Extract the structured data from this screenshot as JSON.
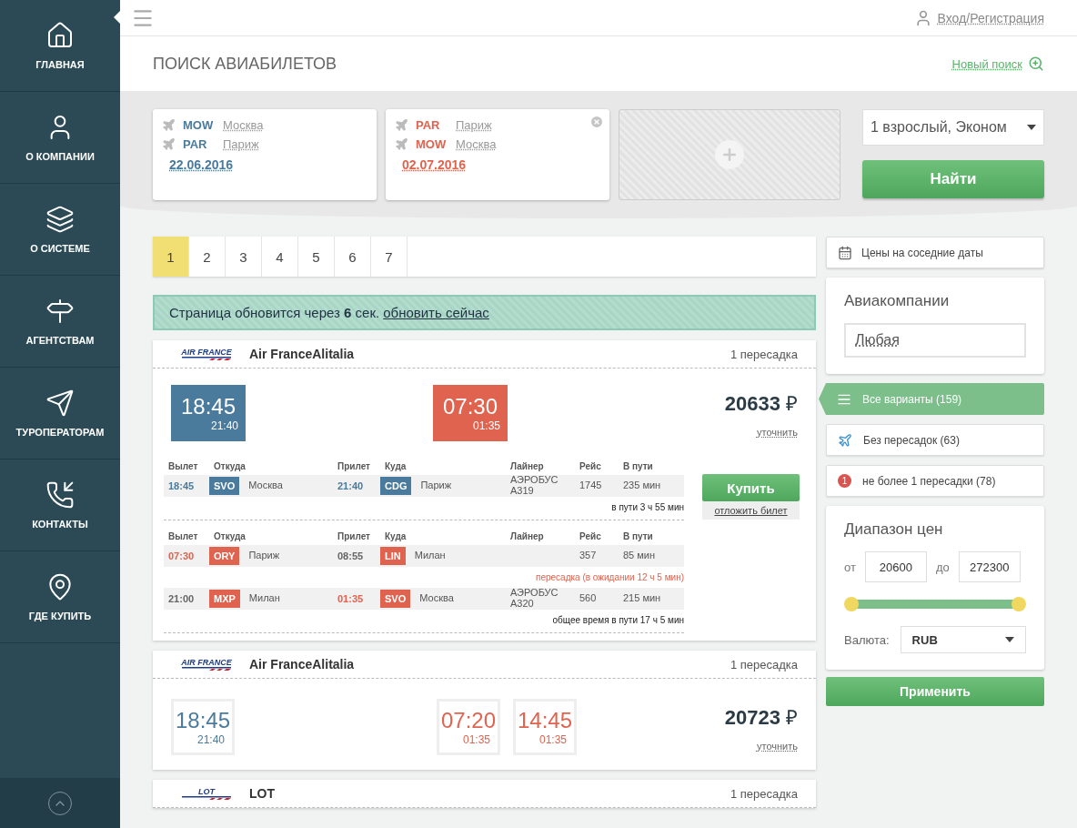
{
  "sidebar": {
    "items": [
      {
        "label": "ГЛАВНАЯ",
        "selected": true
      },
      {
        "label": "О КОМПАНИИ",
        "selected": false
      },
      {
        "label": "О СИСТЕМЕ",
        "selected": false
      },
      {
        "label": "АГЕНТСТВАМ",
        "selected": false
      },
      {
        "label": "ТУРОПЕРАТОРАМ",
        "selected": false
      },
      {
        "label": "КОНТАКТЫ",
        "selected": false
      },
      {
        "label": "ГДЕ КУПИТЬ",
        "selected": false
      }
    ]
  },
  "header": {
    "login": "Вход/Регистрация",
    "page_title": "ПОИСК АВИАБИЛЕТОВ",
    "new_search": "Новый поиск"
  },
  "search": {
    "legs": [
      {
        "color": "#4a7a9c",
        "removable": false,
        "from_code": "MOW",
        "from_city": "Москва",
        "to_code": "PAR",
        "to_city": "Париж",
        "date": "22.06.2016"
      },
      {
        "color": "#e0634f",
        "removable": true,
        "from_code": "PAR",
        "from_city": "Париж",
        "to_code": "MOW",
        "to_city": "Москва",
        "date": "02.07.2016"
      }
    ],
    "passengers": "1 взрослый, Эконом",
    "find_button": "Найти"
  },
  "pagination": [
    {
      "label": "1",
      "selected": true
    },
    {
      "label": "2",
      "selected": false
    },
    {
      "label": "3",
      "selected": false
    },
    {
      "label": "4",
      "selected": false
    },
    {
      "label": "5",
      "selected": false
    },
    {
      "label": "6",
      "selected": false
    },
    {
      "label": "7",
      "selected": false
    }
  ],
  "notice": {
    "text": "Страница обновится через **6** сек.",
    "link": "обновить сейчас"
  },
  "results": [
    {
      "logo": "AIR FRANCE",
      "airline": "Air FranceAlitalia",
      "transfers": "1 пересадка",
      "expanded": true,
      "times": [
        {
          "time": "18:45",
          "sub": "21:40",
          "color": "#4a7a9c"
        },
        {
          "time": "07:30",
          "sub": "01:35",
          "color": "#e0634f"
        }
      ],
      "price": "20633",
      "currency": "₽",
      "refine": "уточнить",
      "buy": "Купить",
      "postpone": "отложить билет",
      "legs": [
        {
          "color": "#4a7a9c",
          "columns": [
            "Вылет",
            "Откуда",
            "Прилет",
            "Куда",
            "Лайнер",
            "Рейс",
            "В пути"
          ],
          "segments": [
            {
              "dep": "18:45",
              "dep_highlight": true,
              "from_code": "SVO",
              "from_city": "Москва",
              "arr": "21:40",
              "arr_highlight": true,
              "to_code": "CDG",
              "to_city": "Париж",
              "aircraft": "АЭРОБУС A319",
              "flight": "1745",
              "duration": "235 мин"
            }
          ],
          "total": "в пути 3 ч 55 мин"
        },
        {
          "color": "#e0634f",
          "columns": [
            "Вылет",
            "Откуда",
            "Прилет",
            "Куда",
            "Лайнер",
            "Рейс",
            "В пути"
          ],
          "segments": [
            {
              "dep": "07:30",
              "dep_highlight": true,
              "from_code": "ORY",
              "from_city": "Париж",
              "arr": "08:55",
              "arr_highlight": false,
              "to_code": "LIN",
              "to_city": "Милан",
              "flight": "357",
              "duration": "85 мин"
            },
            {
              "dep": "21:00",
              "dep_highlight": false,
              "from_code": "MXP",
              "from_city": "Милан",
              "arr": "01:35",
              "arr_highlight": true,
              "to_code": "SVO",
              "to_city": "Москва",
              "aircraft": "АЭРОБУС A320",
              "flight": "560",
              "duration": "215 мин"
            }
          ],
          "transfer": "пересадка (в ожидании 12 ч 5 мин)",
          "total": "общее время в пути 17 ч 5 мин"
        }
      ]
    },
    {
      "logo": "AIR FRANCE",
      "airline": "Air FranceAlitalia",
      "transfers": "1 пересадка",
      "expanded": false,
      "times": [
        {
          "time": "18:45",
          "sub": "21:40",
          "color": "#4a7a9c"
        },
        {
          "time": "07:20",
          "sub": "01:35",
          "color": "#e0634f"
        },
        {
          "time": "14:45",
          "sub": "01:35",
          "color": "#e0634f"
        }
      ],
      "price": "20723",
      "currency": "₽",
      "refine": "уточнить"
    },
    {
      "logo": "LOT",
      "airline": "LOT",
      "transfers": "1 пересадка"
    }
  ],
  "filters": {
    "neighbor_dates": "Цены на соседние даты",
    "airlines_title": "Авиакомпании",
    "airlines_value": "Любая",
    "options": [
      {
        "kind": "list",
        "label": "Все варианты (159)",
        "selected": true
      },
      {
        "kind": "plane",
        "label": "Без пересадок (63)",
        "selected": false
      },
      {
        "kind": "badge",
        "badge": "1",
        "label": "не более 1 пересадки (78)",
        "selected": false
      }
    ],
    "price_title": "Диапазон цен",
    "from_label": "от",
    "from": "20600",
    "to_label": "до",
    "to": "272300",
    "level": 1,
    "currency_label": "Валюта:",
    "currency": "RUB",
    "apply": "Применить"
  }
}
